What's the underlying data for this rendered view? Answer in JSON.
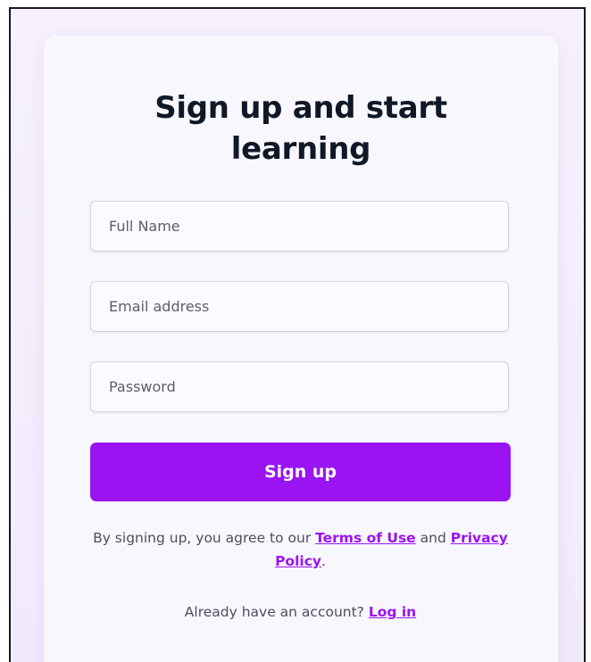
{
  "signup": {
    "title_line1": "Sign up and start",
    "title_line2": "learning",
    "fields": {
      "full_name_placeholder": "Full Name",
      "email_placeholder": "Email address",
      "password_placeholder": "Password"
    },
    "submit_label": "Sign up",
    "terms": {
      "prefix": "By signing up, you agree to our ",
      "terms_link": "Terms of Use",
      "middle": " and ",
      "privacy_link": "Privacy Policy",
      "suffix": "."
    },
    "login": {
      "prompt": "Already have an account? ",
      "link": "Log in"
    }
  },
  "colors": {
    "accent": "#9a13f2",
    "heading": "#101828",
    "body_text": "#4a4f5c",
    "page_background": "#f3edfc",
    "card_background": "#f9f7fe"
  }
}
